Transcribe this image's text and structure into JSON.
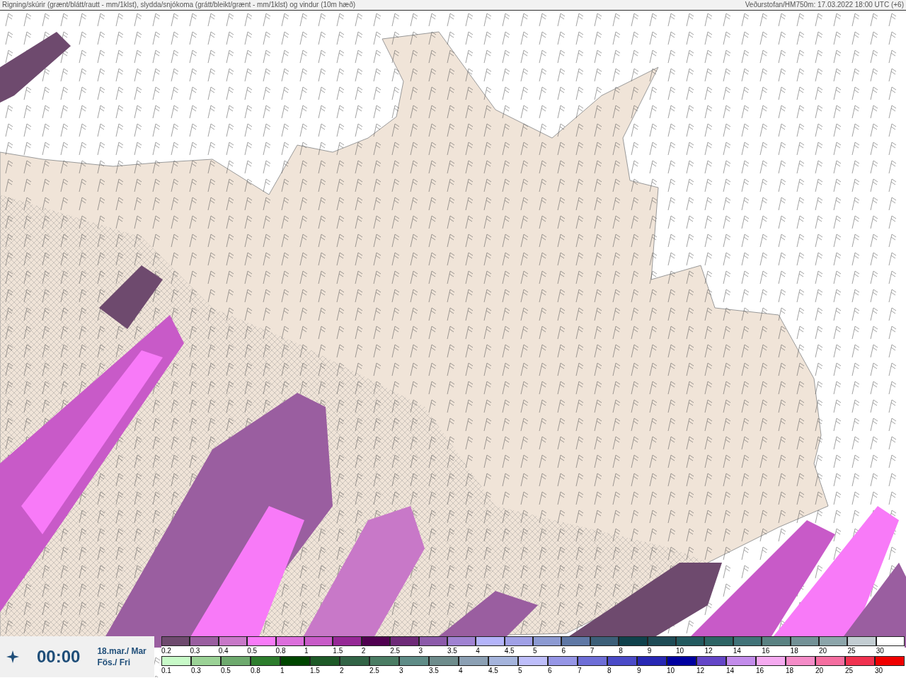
{
  "header": {
    "title": "Rigning/skúrir (grænt/blátt/rautt - mm/1klst), slydda/snjókoma (grátt/bleikt/grænt - mm/1klst) og vindur (10m hæð)",
    "source": "Veðurstofan/HM750m: 17.03.2022 18:00 UTC (+6)"
  },
  "time_panel": {
    "time": "00:00",
    "date_lines": [
      "18.mar./ Mar",
      "Fös./ Fri"
    ]
  },
  "legend_top": [
    {
      "label": "0.2",
      "color": "#6e4a6e"
    },
    {
      "label": "0.3",
      "color": "#9a5ea0"
    },
    {
      "label": "0.4",
      "color": "#c878c8"
    },
    {
      "label": "0.5",
      "color": "#f87af8"
    },
    {
      "label": "0.8",
      "color": "#dc6edc"
    },
    {
      "label": "1",
      "color": "#c85ac8"
    },
    {
      "label": "1.5",
      "color": "#962896"
    },
    {
      "label": "2",
      "color": "#500050"
    },
    {
      "label": "2.5",
      "color": "#6e2a78"
    },
    {
      "label": "3",
      "color": "#8c5aaa"
    },
    {
      "label": "3.5",
      "color": "#a082d2"
    },
    {
      "label": "4",
      "color": "#b4b4fa"
    },
    {
      "label": "4.5",
      "color": "#a0a0e6"
    },
    {
      "label": "5",
      "color": "#8c9ad2"
    },
    {
      "label": "6",
      "color": "#5f78a5"
    },
    {
      "label": "7",
      "color": "#3c5f78"
    },
    {
      "label": "8",
      "color": "#0f414b"
    },
    {
      "label": "9",
      "color": "#1e4b55"
    },
    {
      "label": "10",
      "color": "#235a5f"
    },
    {
      "label": "12",
      "color": "#2d6464"
    },
    {
      "label": "14",
      "color": "#417378"
    },
    {
      "label": "16",
      "color": "#5a8282"
    },
    {
      "label": "18",
      "color": "#739196"
    },
    {
      "label": "20",
      "color": "#8ca5aa"
    },
    {
      "label": "25",
      "color": "#c3cdd2"
    },
    {
      "label": "30",
      "color": "#ffffff"
    }
  ],
  "legend_bottom": [
    {
      "label": "0.1",
      "color": "#c8fac8"
    },
    {
      "label": "0.3",
      "color": "#9bd296"
    },
    {
      "label": "0.5",
      "color": "#6eaa6e"
    },
    {
      "label": "0.8",
      "color": "#2d7d2d"
    },
    {
      "label": "1",
      "color": "#004600"
    },
    {
      "label": "1.5",
      "color": "#1e5a28"
    },
    {
      "label": "2",
      "color": "#326446"
    },
    {
      "label": "2.5",
      "color": "#4b7d64"
    },
    {
      "label": "3",
      "color": "#5f8c87"
    },
    {
      "label": "3.5",
      "color": "#6e8c8c"
    },
    {
      "label": "4",
      "color": "#8ca0b4"
    },
    {
      "label": "4.5",
      "color": "#a5b4dc"
    },
    {
      "label": "5",
      "color": "#bebefa"
    },
    {
      "label": "6",
      "color": "#9696e6"
    },
    {
      "label": "7",
      "color": "#6e6ed7"
    },
    {
      "label": "8",
      "color": "#4b4bc8"
    },
    {
      "label": "9",
      "color": "#2828b4"
    },
    {
      "label": "10",
      "color": "#0000a0"
    },
    {
      "label": "12",
      "color": "#6446c8"
    },
    {
      "label": "14",
      "color": "#c38ceb"
    },
    {
      "label": "16",
      "color": "#f5aaf0"
    },
    {
      "label": "18",
      "color": "#f58cc8"
    },
    {
      "label": "20",
      "color": "#f56ea0"
    },
    {
      "label": "25",
      "color": "#f03250"
    },
    {
      "label": "30",
      "color": "#f00000"
    }
  ]
}
